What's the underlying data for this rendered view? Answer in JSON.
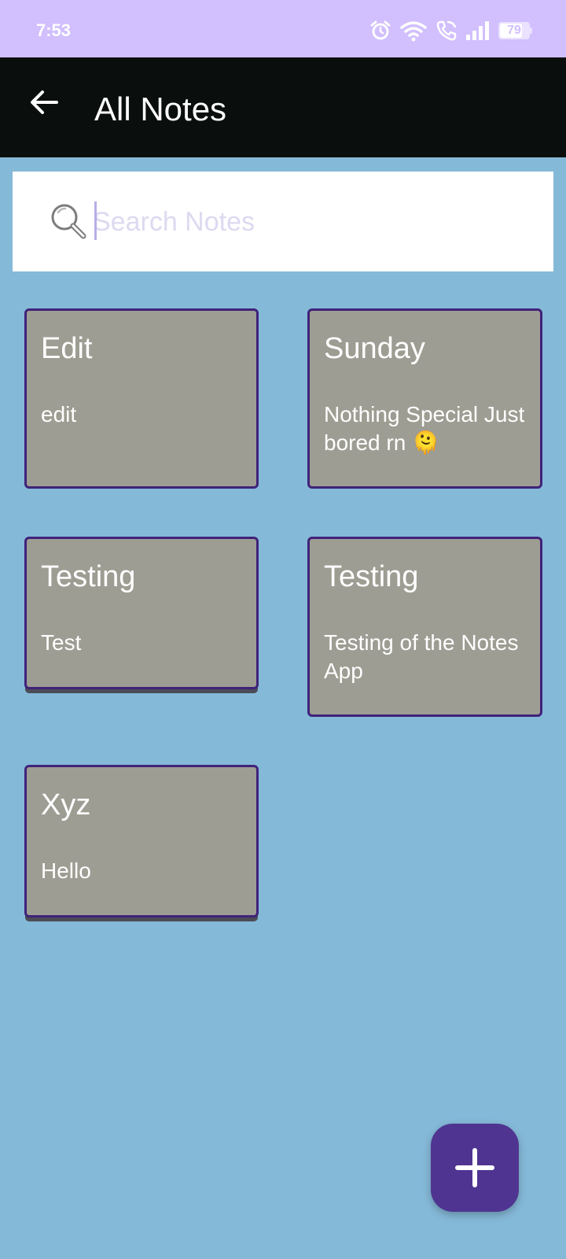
{
  "status_bar": {
    "time": "7:53",
    "battery_level": "79",
    "icons": [
      "alarm-icon",
      "wifi-icon",
      "wifi-calling-icon",
      "signal-icon",
      "battery-icon"
    ]
  },
  "app_bar": {
    "title": "All Notes",
    "back_icon": "arrow-left-icon"
  },
  "search": {
    "placeholder": "Search Notes",
    "value": "",
    "icon": "magnifier-icon"
  },
  "notes": [
    {
      "title": "Edit",
      "body": "edit"
    },
    {
      "title": "Sunday",
      "body": "Nothing Special Just bored rn 🫠"
    },
    {
      "title": "Testing",
      "body": "Test"
    },
    {
      "title": "Testing",
      "body": "Testing of the Notes App"
    },
    {
      "title": "Xyz",
      "body": "Hello"
    }
  ],
  "fab": {
    "icon": "plus-icon"
  },
  "colors": {
    "status_bar": "#d1bffe",
    "app_bar": "#0a0f0d",
    "background": "#85b9d8",
    "card": "#9d9d93",
    "card_border": "#40227a",
    "fab": "#4f3591"
  }
}
